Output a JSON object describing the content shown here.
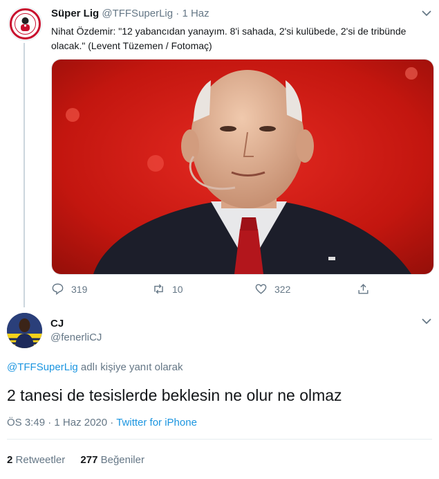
{
  "original_tweet": {
    "author_name": "Süper Lig",
    "author_handle": "@TFFSuperLig",
    "separator": "·",
    "date": "1 Haz",
    "text": "Nihat Özdemir: \"12 yabancıdan yanayım. 8'i sahada, 2'si kulübede, 2'si de tribünde olacak.\" (Levent Tüzemen / Fotomaç)",
    "avatar_icon": "league-logo-icon",
    "media_icon": "portrait-photo",
    "actions": {
      "reply_count": "319",
      "retweet_count": "10",
      "like_count": "322"
    }
  },
  "reply_tweet": {
    "author_name": "CJ",
    "author_handle": "@fenerliCJ",
    "avatar_icon": "user-avatar",
    "reply_to_handle": "@TFFSuperLig",
    "reply_to_suffix": " adlı kişiye yanıt olarak",
    "text": "2 tanesi de tesislerde beklesin ne olur ne olmaz",
    "time": "ÖS 3:49",
    "separator1": "·",
    "date": "1 Haz 2020",
    "separator2": "·",
    "source": "Twitter for iPhone",
    "stats": {
      "retweets_count": "2",
      "retweets_label": "Retweetler",
      "likes_count": "277",
      "likes_label": "Beğeniler"
    }
  },
  "colors": {
    "link": "#1b95e0",
    "muted": "#657786",
    "thread_line": "#ccd6dd"
  }
}
